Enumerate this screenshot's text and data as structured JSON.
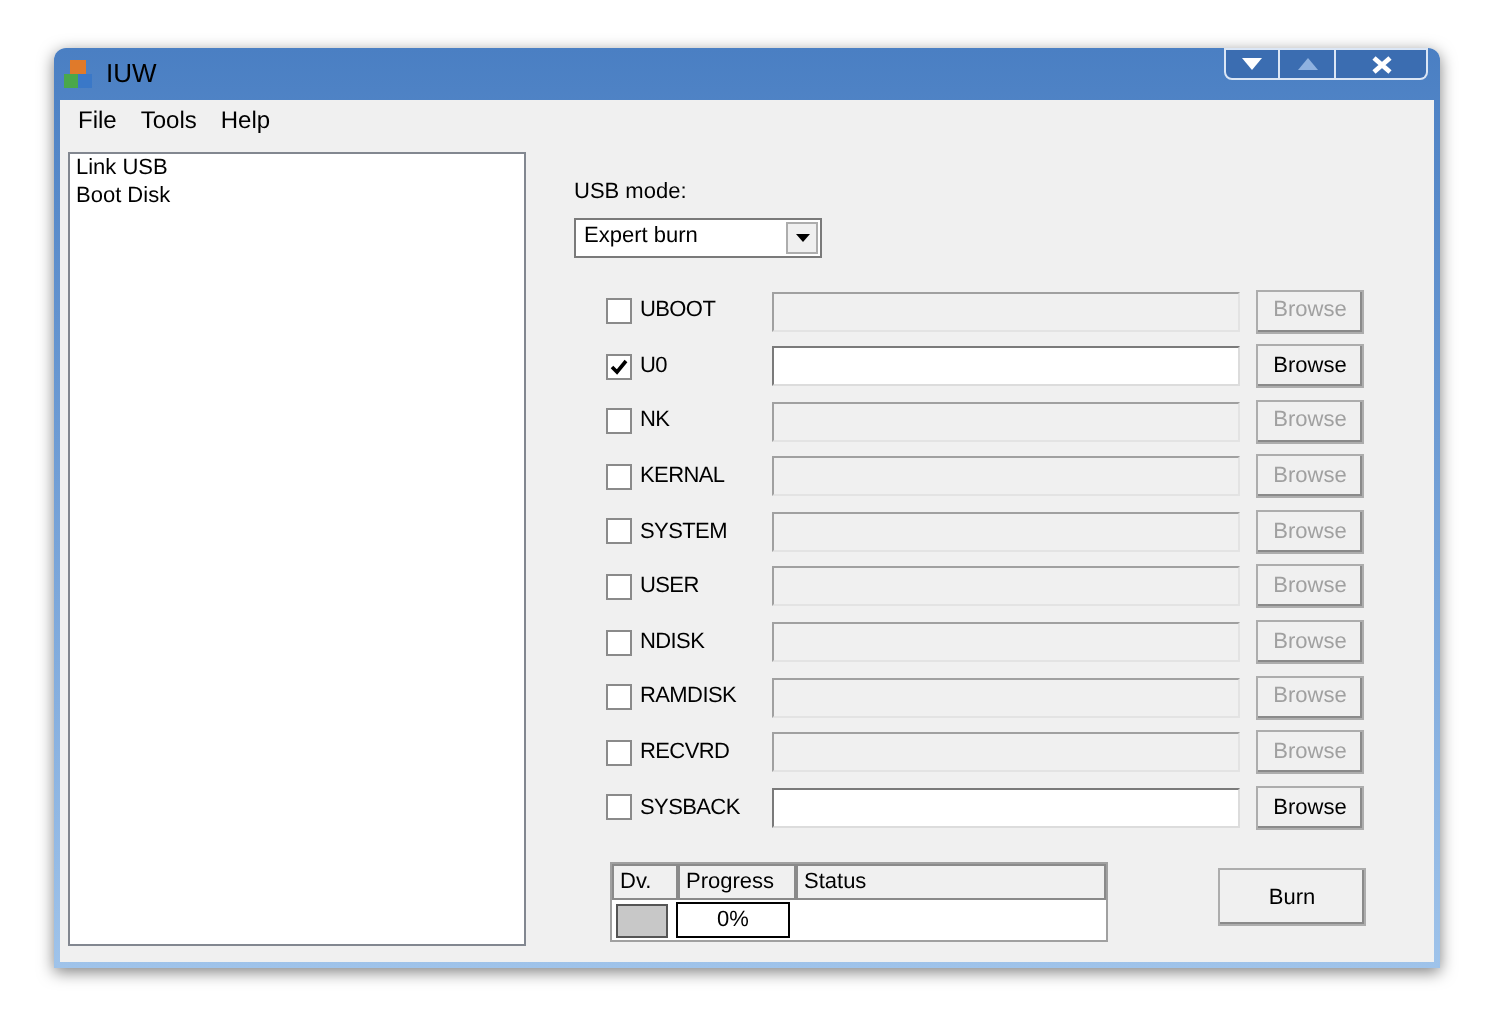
{
  "window": {
    "title": "IUW"
  },
  "menu": [
    "File",
    "Tools",
    "Help"
  ],
  "list": [
    "Link USB",
    "Boot Disk"
  ],
  "usb_mode": {
    "label": "USB mode:",
    "value": "Expert burn"
  },
  "images": [
    {
      "name": "UBOOT",
      "checked": false,
      "enabled": false,
      "button": "Browse"
    },
    {
      "name": "U0",
      "checked": true,
      "enabled": true,
      "button": "Browse"
    },
    {
      "name": "NK",
      "checked": false,
      "enabled": false,
      "button": "Browse"
    },
    {
      "name": "KERNAL",
      "checked": false,
      "enabled": false,
      "button": "Browse"
    },
    {
      "name": "SYSTEM",
      "checked": false,
      "enabled": false,
      "button": "Browse"
    },
    {
      "name": "USER",
      "checked": false,
      "enabled": false,
      "button": "Browse"
    },
    {
      "name": "NDISK",
      "checked": false,
      "enabled": false,
      "button": "Browse"
    },
    {
      "name": "RAMDISK",
      "checked": false,
      "enabled": false,
      "button": "Browse"
    },
    {
      "name": "RECVRD",
      "checked": false,
      "enabled": false,
      "button": "Browse"
    },
    {
      "name": "SYSBACK",
      "checked": false,
      "enabled": true,
      "button": "Browse"
    }
  ],
  "device_table": {
    "columns": [
      "Dv.",
      "Progress",
      "Status"
    ],
    "rows": [
      {
        "progress": "0%"
      }
    ]
  },
  "burn_button": "Burn"
}
